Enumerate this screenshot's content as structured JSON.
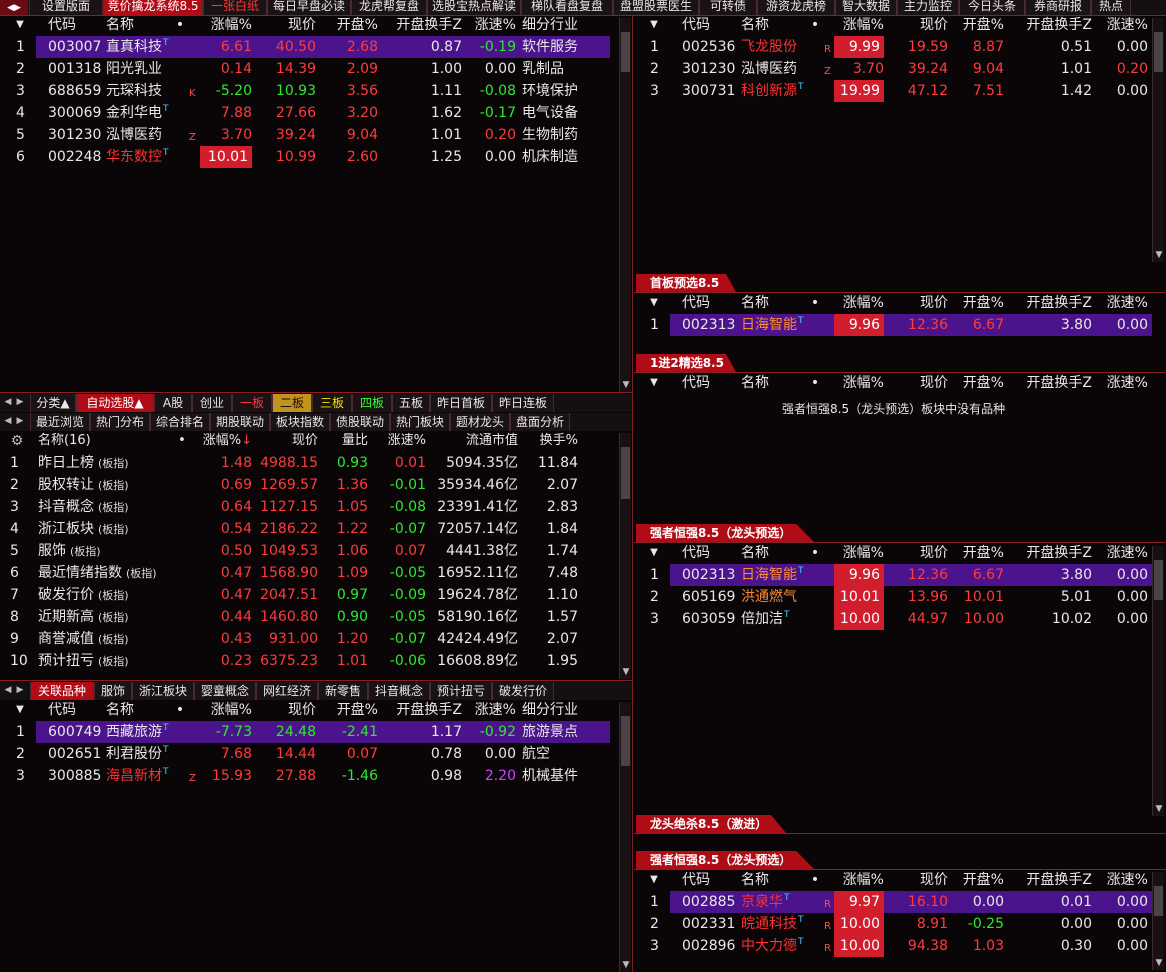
{
  "top_tabs": [
    "设置版面",
    "竞价擒龙系统8.5",
    "一张白纸",
    "每日早盘必读",
    "龙虎帮复盘",
    "选股宝热点解读",
    "梯队看盘复盘",
    "盘盟股票医生",
    "可转债",
    "游资龙虎榜",
    "智大数据",
    "主力监控",
    "今日头条",
    "券商研报",
    "热点"
  ],
  "cols_main": [
    "代码",
    "名称",
    "•",
    "涨幅%",
    "现价",
    "开盘%",
    "开盘换手Z",
    "涨速%",
    "细分行业"
  ],
  "cols_right": [
    "代码",
    "名称",
    "•",
    "涨幅%",
    "现价",
    "开盘%",
    "开盘换手Z",
    "涨速%"
  ],
  "p1": {
    "rows": [
      {
        "no": "1",
        "code": "003007",
        "name": "直真科技",
        "sup": "T",
        "tag": "",
        "chg": "6.61",
        "price": "40.50",
        "open": "2.68",
        "turn": "0.87",
        "spd": "-0.19",
        "ind": "软件服务"
      },
      {
        "no": "2",
        "code": "001318",
        "name": "阳光乳业",
        "sup": "",
        "tag": "",
        "chg": "0.14",
        "price": "14.39",
        "open": "2.09",
        "turn": "1.00",
        "spd": "0.00",
        "ind": "乳制品"
      },
      {
        "no": "3",
        "code": "688659",
        "name": "元琛科技",
        "sup": "",
        "tag": "K",
        "chg": "-5.20",
        "price": "10.93",
        "open": "3.56",
        "turn": "1.11",
        "spd": "-0.08",
        "ind": "环境保护"
      },
      {
        "no": "4",
        "code": "300069",
        "name": "金利华电",
        "sup": "T",
        "tag": "",
        "chg": "7.88",
        "price": "27.66",
        "open": "3.20",
        "turn": "1.62",
        "spd": "-0.17",
        "ind": "电气设备"
      },
      {
        "no": "5",
        "code": "301230",
        "name": "泓博医药",
        "sup": "",
        "tag": "Z",
        "chg": "3.70",
        "price": "39.24",
        "open": "9.04",
        "turn": "1.01",
        "spd": "0.20",
        "ind": "生物制药"
      },
      {
        "no": "6",
        "code": "002248",
        "name": "华东数控",
        "sup": "T",
        "tag": "",
        "chg": "10.01",
        "price": "10.99",
        "open": "2.60",
        "turn": "1.25",
        "spd": "0.00",
        "ind": "机床制造"
      }
    ]
  },
  "mid_tabs1": [
    "分类▲",
    "自动选股▲",
    "A股",
    "创业",
    "一板",
    "二板",
    "三板",
    "四板",
    "五板",
    "昨日首板",
    "昨日连板"
  ],
  "mid_tabs2": [
    "最近浏览",
    "热门分布",
    "综合排名",
    "期股联动",
    "板块指数",
    "债股联动",
    "热门板块",
    "题材龙头",
    "盘面分析"
  ],
  "p2": {
    "headers": [
      "名称(16)",
      "•",
      "涨幅%↓",
      "现价",
      "量比",
      "涨速%",
      "流通市值",
      "换手%"
    ],
    "rows": [
      {
        "no": "1",
        "name": "昨日上榜",
        "chg": "1.48",
        "price": "4988.15",
        "vol": "0.93",
        "spd": "0.01",
        "mcap": "5094.35亿",
        "turn": "11.84"
      },
      {
        "no": "2",
        "name": "股权转让",
        "chg": "0.69",
        "price": "1269.57",
        "vol": "1.36",
        "spd": "-0.01",
        "mcap": "35934.46亿",
        "turn": "2.07"
      },
      {
        "no": "3",
        "name": "抖音概念",
        "chg": "0.64",
        "price": "1127.15",
        "vol": "1.05",
        "spd": "-0.08",
        "mcap": "23391.41亿",
        "turn": "2.83"
      },
      {
        "no": "4",
        "name": "浙江板块",
        "chg": "0.54",
        "price": "2186.22",
        "vol": "1.22",
        "spd": "-0.07",
        "mcap": "72057.14亿",
        "turn": "1.84"
      },
      {
        "no": "5",
        "name": "服饰",
        "chg": "0.50",
        "price": "1049.53",
        "vol": "1.06",
        "spd": "0.07",
        "mcap": "4441.38亿",
        "turn": "1.74"
      },
      {
        "no": "6",
        "name": "最近情绪指数",
        "chg": "0.47",
        "price": "1568.90",
        "vol": "1.09",
        "spd": "-0.05",
        "mcap": "16952.11亿",
        "turn": "7.48"
      },
      {
        "no": "7",
        "name": "破发行价",
        "chg": "0.47",
        "price": "2047.51",
        "vol": "0.97",
        "spd": "-0.09",
        "mcap": "19624.78亿",
        "turn": "1.10"
      },
      {
        "no": "8",
        "name": "近期新高",
        "chg": "0.44",
        "price": "1460.80",
        "vol": "0.90",
        "spd": "-0.05",
        "mcap": "58190.16亿",
        "turn": "1.57"
      },
      {
        "no": "9",
        "name": "商誉减值",
        "chg": "0.43",
        "price": "931.00",
        "vol": "1.20",
        "spd": "-0.07",
        "mcap": "42424.49亿",
        "turn": "2.07"
      },
      {
        "no": "10",
        "name": "预计扭亏",
        "chg": "0.23",
        "price": "6375.23",
        "vol": "1.01",
        "spd": "-0.06",
        "mcap": "16608.89亿",
        "turn": "1.95"
      }
    ],
    "suffix": "(板指)"
  },
  "bot_tabs": [
    "关联品种",
    "服饰",
    "浙江板块",
    "婴童概念",
    "网红经济",
    "新零售",
    "抖音概念",
    "预计扭亏",
    "破发行价"
  ],
  "p3": {
    "rows": [
      {
        "no": "1",
        "code": "600749",
        "name": "西藏旅游",
        "sup": "T",
        "tag": "",
        "chg": "-7.73",
        "price": "24.48",
        "open": "-2.41",
        "turn": "1.17",
        "spd": "-0.92",
        "ind": "旅游景点"
      },
      {
        "no": "2",
        "code": "002651",
        "name": "利君股份",
        "sup": "T",
        "tag": "",
        "chg": "7.68",
        "price": "14.44",
        "open": "0.07",
        "turn": "0.78",
        "spd": "0.00",
        "ind": "航空"
      },
      {
        "no": "3",
        "code": "300885",
        "name": "海昌新材",
        "sup": "T",
        "tag": "Z",
        "chg": "15.93",
        "price": "27.88",
        "open": "-1.46",
        "turn": "0.98",
        "spd": "2.20",
        "ind": "机械基件"
      }
    ]
  },
  "r1": {
    "rows": [
      {
        "no": "1",
        "code": "002536",
        "name": "飞龙股份",
        "sup": "",
        "tag": "R",
        "chg": "9.99",
        "price": "19.59",
        "open": "8.87",
        "turn": "0.51",
        "spd": "0.00"
      },
      {
        "no": "2",
        "code": "301230",
        "name": "泓博医药",
        "sup": "",
        "tag": "Z",
        "chg": "3.70",
        "price": "39.24",
        "open": "9.04",
        "turn": "1.01",
        "spd": "0.20"
      },
      {
        "no": "3",
        "code": "300731",
        "name": "科创新源",
        "sup": "T",
        "tag": "",
        "chg": "19.99",
        "price": "47.12",
        "open": "7.51",
        "turn": "1.42",
        "spd": "0.00"
      }
    ]
  },
  "r2": {
    "label": "首板预选8.5",
    "rows": [
      {
        "no": "1",
        "code": "002313",
        "name": "日海智能",
        "sup": "T",
        "tag": "",
        "chg": "9.96",
        "price": "12.36",
        "open": "6.67",
        "turn": "3.80",
        "spd": "0.00"
      }
    ]
  },
  "r3": {
    "label": "1进2精选8.5",
    "empty_note": "强者恒强8.5（龙头预选）板块中没有品种"
  },
  "r4": {
    "label": "强者恒强8.5（龙头预选）",
    "rows": [
      {
        "no": "1",
        "code": "002313",
        "name": "日海智能",
        "sup": "T",
        "tag": "",
        "chg": "9.96",
        "price": "12.36",
        "open": "6.67",
        "turn": "3.80",
        "spd": "0.00"
      },
      {
        "no": "2",
        "code": "605169",
        "name": "洪通燃气",
        "sup": "",
        "tag": "",
        "chg": "10.01",
        "price": "13.96",
        "open": "10.01",
        "turn": "5.01",
        "spd": "0.00"
      },
      {
        "no": "3",
        "code": "603059",
        "name": "倍加洁",
        "sup": "T",
        "tag": "",
        "chg": "10.00",
        "price": "44.97",
        "open": "10.00",
        "turn": "10.02",
        "spd": "0.00"
      }
    ]
  },
  "r5": {
    "label": "龙头绝杀8.5（激进）"
  },
  "r6": {
    "label": "强者恒强8.5（龙头预选）",
    "rows": [
      {
        "no": "1",
        "code": "002885",
        "name": "京泉华",
        "sup": "T",
        "tag": "R",
        "chg": "9.97",
        "price": "16.10",
        "open": "0.00",
        "turn": "0.01",
        "spd": "0.00"
      },
      {
        "no": "2",
        "code": "002331",
        "name": "皖通科技",
        "sup": "T",
        "tag": "R",
        "chg": "10.00",
        "price": "8.91",
        "open": "-0.25",
        "turn": "0.00",
        "spd": "0.00"
      },
      {
        "no": "3",
        "code": "002896",
        "name": "中大力德",
        "sup": "T",
        "tag": "R",
        "chg": "10.00",
        "price": "94.38",
        "open": "1.03",
        "turn": "0.30",
        "spd": "0.00"
      }
    ]
  },
  "colors": {
    "accent": "#b00c16",
    "up": "#ff3b3b",
    "down": "#2ee82e",
    "select": "#4b148c"
  }
}
